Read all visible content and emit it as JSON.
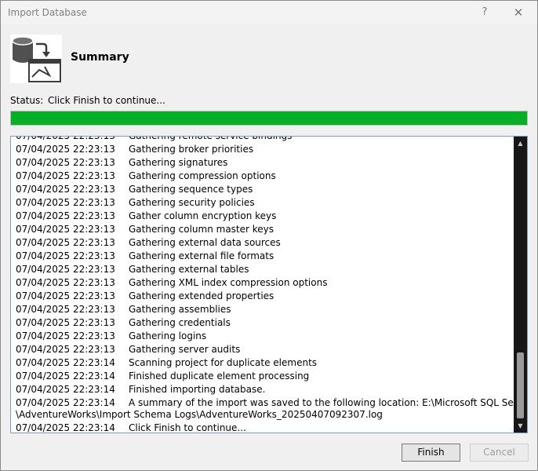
{
  "window": {
    "title": "Import Database",
    "help_label": "?",
    "close_label": "✕"
  },
  "header": {
    "title": "Summary",
    "icon": "database-import-icon"
  },
  "status": {
    "label": "Status:",
    "text": "Click Finish to continue...",
    "progress_percent": 100,
    "progress_color": "#06b025"
  },
  "log": {
    "rows": [
      {
        "time": "07/04/2025 22:23:13",
        "message": "Gathering remote service bindings"
      },
      {
        "time": "07/04/2025 22:23:13",
        "message": "Gathering broker priorities"
      },
      {
        "time": "07/04/2025 22:23:13",
        "message": "Gathering signatures"
      },
      {
        "time": "07/04/2025 22:23:13",
        "message": "Gathering compression options"
      },
      {
        "time": "07/04/2025 22:23:13",
        "message": "Gathering sequence types"
      },
      {
        "time": "07/04/2025 22:23:13",
        "message": "Gathering security policies"
      },
      {
        "time": "07/04/2025 22:23:13",
        "message": "Gather column encryption keys"
      },
      {
        "time": "07/04/2025 22:23:13",
        "message": "Gathering column master keys"
      },
      {
        "time": "07/04/2025 22:23:13",
        "message": "Gathering external data sources"
      },
      {
        "time": "07/04/2025 22:23:13",
        "message": "Gathering external file formats"
      },
      {
        "time": "07/04/2025 22:23:13",
        "message": "Gathering external tables"
      },
      {
        "time": "07/04/2025 22:23:13",
        "message": "Gathering XML index compression options"
      },
      {
        "time": "07/04/2025 22:23:13",
        "message": "Gathering extended properties"
      },
      {
        "time": "07/04/2025 22:23:13",
        "message": "Gathering assemblies"
      },
      {
        "time": "07/04/2025 22:23:13",
        "message": "Gathering credentials"
      },
      {
        "time": "07/04/2025 22:23:13",
        "message": "Gathering logins"
      },
      {
        "time": "07/04/2025 22:23:13",
        "message": "Gathering server audits"
      },
      {
        "time": "07/04/2025 22:23:14",
        "message": "Scanning project for duplicate elements"
      },
      {
        "time": "07/04/2025 22:23:14",
        "message": "Finished duplicate element processing"
      },
      {
        "time": "07/04/2025 22:23:14",
        "message": "Finished importing database."
      },
      {
        "time": "07/04/2025 22:23:14",
        "message": "A summary of the import was saved to the following location: E:\\Microsoft SQL Server\\repos",
        "continuation": "\\AdventureWorks\\Import Schema Logs\\AdventureWorks_20250407092307.log"
      },
      {
        "time": "07/04/2025 22:23:14",
        "message": "Click Finish to continue..."
      }
    ]
  },
  "buttons": {
    "finish": "Finish",
    "cancel": "Cancel"
  }
}
